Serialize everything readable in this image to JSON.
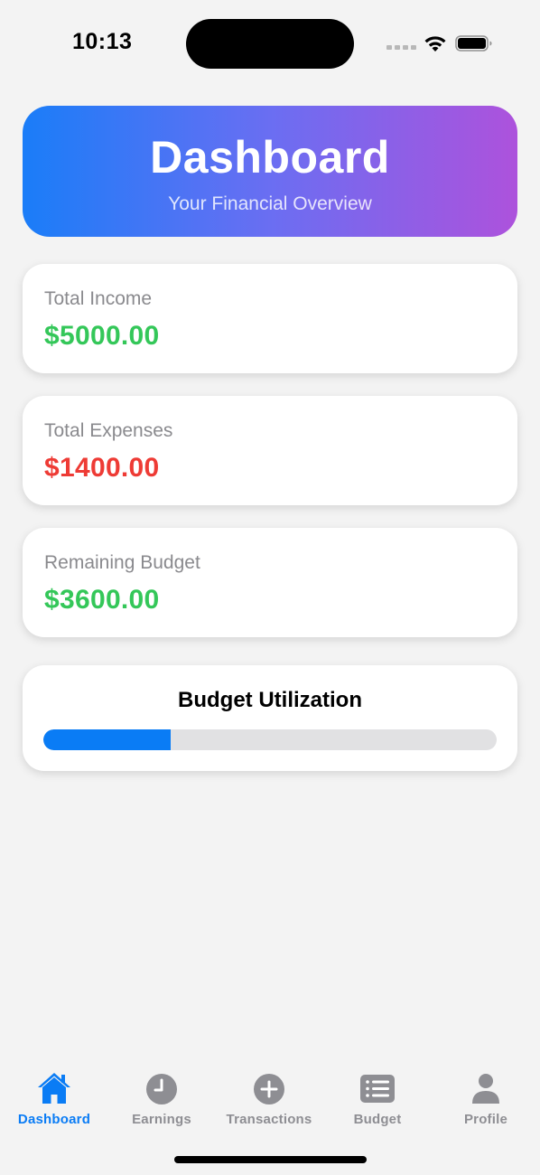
{
  "status_bar": {
    "time": "10:13"
  },
  "header": {
    "title": "Dashboard",
    "subtitle": "Your Financial Overview",
    "gradient_colors": [
      "#1a7df8",
      "#ad52dc"
    ]
  },
  "stats": [
    {
      "label": "Total Income",
      "value": "$5000.00",
      "color": "#34c759"
    },
    {
      "label": "Total Expenses",
      "value": "$1400.00",
      "color": "#ee3b35"
    },
    {
      "label": "Remaining Budget",
      "value": "$3600.00",
      "color": "#34c759"
    }
  ],
  "budget_utilization": {
    "title": "Budget Utilization",
    "progress_fraction": 0.28,
    "fill_color": "#0a7cf5",
    "track_color": "#e1e1e3"
  },
  "tab_bar": {
    "active_color": "#0a7cf5",
    "inactive_color": "#8e8e93",
    "items": [
      {
        "label": "Dashboard",
        "icon": "house-icon",
        "active": true
      },
      {
        "label": "Earnings",
        "icon": "clock-icon",
        "active": false
      },
      {
        "label": "Transactions",
        "icon": "plus-circle-icon",
        "active": false
      },
      {
        "label": "Budget",
        "icon": "list-icon",
        "active": false
      },
      {
        "label": "Profile",
        "icon": "person-icon",
        "active": false
      }
    ]
  }
}
